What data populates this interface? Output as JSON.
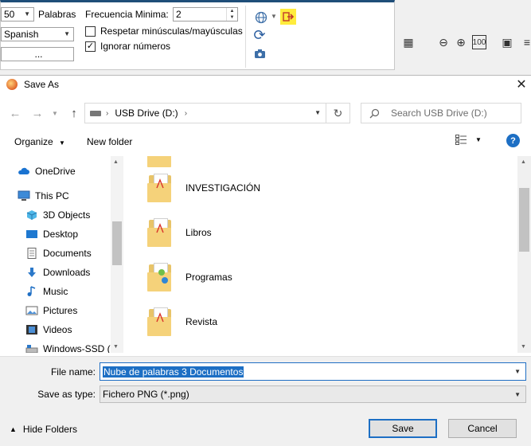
{
  "background_app": {
    "words_value": "50",
    "words_label": "Palabras",
    "language": "Spanish",
    "ellipsis": "...",
    "min_freq_label": "Frecuencia Minima:",
    "min_freq_value": "2",
    "case_label": "Respetar minúsculas/mayúsculas",
    "case_checked": false,
    "ignore_numbers_label": "Ignorar números",
    "ignore_numbers_checked": true
  },
  "dialog": {
    "title": "Save As",
    "address": {
      "path_item": "USB Drive (D:)"
    },
    "search_placeholder": "Search USB Drive (D:)",
    "toolbar": {
      "organize": "Organize",
      "new_folder": "New folder"
    },
    "nav_items": [
      {
        "label": "OneDrive",
        "icon": "cloud-icon"
      },
      {
        "label": "This PC",
        "icon": "pc-icon"
      },
      {
        "label": "3D Objects",
        "icon": "cube-icon"
      },
      {
        "label": "Desktop",
        "icon": "desktop-icon"
      },
      {
        "label": "Documents",
        "icon": "documents-icon"
      },
      {
        "label": "Downloads",
        "icon": "download-icon"
      },
      {
        "label": "Music",
        "icon": "music-icon"
      },
      {
        "label": "Pictures",
        "icon": "pictures-icon"
      },
      {
        "label": "Videos",
        "icon": "videos-icon"
      },
      {
        "label": "Windows-SSD (C",
        "icon": "drive-icon"
      }
    ],
    "files": [
      {
        "name": "INVESTIGACIÓN"
      },
      {
        "name": "Libros"
      },
      {
        "name": "Programas"
      },
      {
        "name": "Revista"
      }
    ],
    "file_name_label": "File name:",
    "file_name_value": "Nube de palabras 3 Documentos",
    "save_type_label": "Save as type:",
    "save_type_value": "Fichero PNG (*.png)",
    "hide_folders": "Hide Folders",
    "save_button": "Save",
    "cancel_button": "Cancel"
  },
  "colors": {
    "accent": "#1d6fc4",
    "folder": "#f5d27a",
    "highlight_icon_bg": "#ffec3d"
  }
}
